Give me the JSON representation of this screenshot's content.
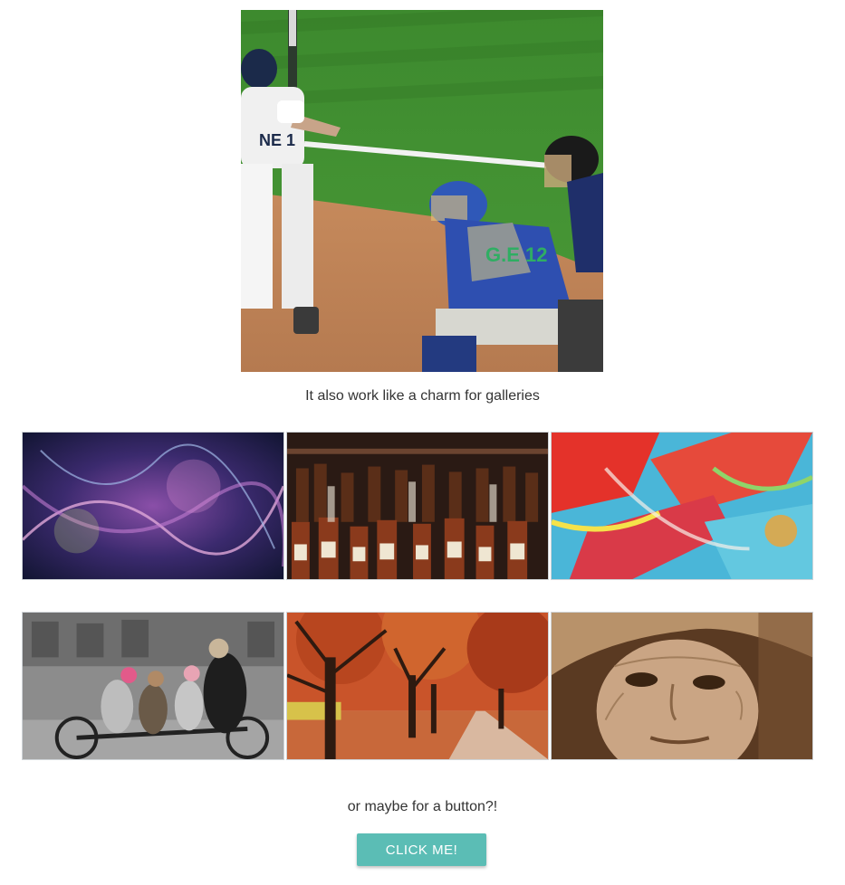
{
  "hero": {
    "image_label": "baseball batter, catcher and umpire at home plate",
    "jersey_text": "NE 1",
    "catcher_jersey_text": "G.E 12"
  },
  "gallery_caption": "It also work like a charm for galleries",
  "gallery": {
    "rows": [
      [
        {
          "subject": "abstract purple swirl art"
        },
        {
          "subject": "bottles on bar shelves"
        },
        {
          "subject": "red and blue abstract paint"
        }
      ],
      [
        {
          "subject": "family riding tandem bicycle, black and white"
        },
        {
          "subject": "autumn trees over park path"
        },
        {
          "subject": "elderly woman in hat, sepia portrait"
        }
      ]
    ]
  },
  "button_caption": "or maybe for a button?!",
  "button": {
    "label": "CLICK ME!"
  },
  "colors": {
    "button_bg": "#5bbdb5",
    "button_text": "#ffffff",
    "text": "#333333",
    "thumb_border": "#cfd4d8"
  }
}
